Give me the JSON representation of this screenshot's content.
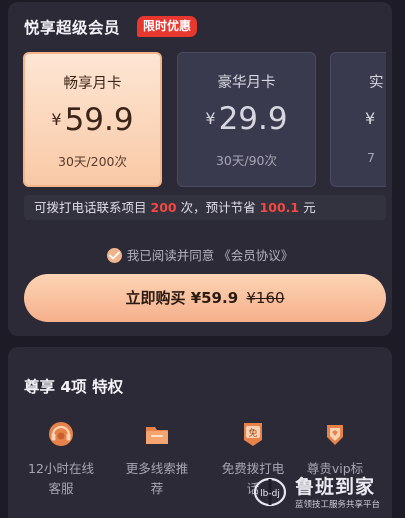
{
  "header": {
    "title": "悦享超级会员",
    "badge": "限时优惠"
  },
  "plans": [
    {
      "name": "畅享月卡",
      "currency": "¥",
      "price": "59.9",
      "period": "30天/200次",
      "selected": true
    },
    {
      "name": "豪华月卡",
      "currency": "¥",
      "price": "29.9",
      "period": "30天/90次",
      "selected": false
    },
    {
      "name": "实",
      "currency": "¥",
      "price": "",
      "period": "7",
      "selected": false
    }
  ],
  "call_info": {
    "prefix": "可拨打电话联系项目",
    "count": "200",
    "mid": "次，预计节省",
    "saving": "100.1",
    "suffix": "元"
  },
  "agreement": {
    "text": "我已阅读并同意",
    "link": "《会员协议》"
  },
  "buy_button": {
    "label": "立即购买",
    "price": "¥59.9",
    "original_price": "¥160"
  },
  "privileges": {
    "title": "尊享 4项 特权",
    "items": [
      {
        "label": "12小时在线\n客服",
        "icon": "headset-icon"
      },
      {
        "label": "更多线索推\n荐",
        "icon": "folder-icon"
      },
      {
        "label": "免费拨打电\n话",
        "icon": "free-call-icon"
      },
      {
        "label": "尊贵vip标",
        "icon": "vip-badge-icon"
      }
    ]
  },
  "watermark": {
    "name": "鲁班到家",
    "slogan": "蓝领技工服务共享平台",
    "logo_text": "lb-dj"
  },
  "colors": {
    "accent": "#f6b08c",
    "highlight": "#f04a42",
    "badge": "#e8372f",
    "panel": "#2b2a36"
  }
}
